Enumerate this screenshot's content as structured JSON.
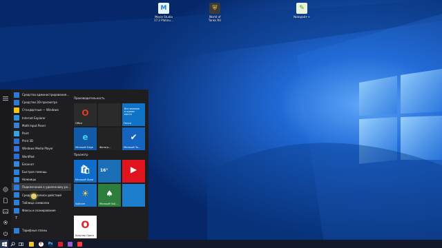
{
  "desktop": {
    "icons": [
      {
        "label": "Movie Studio\n17.2 Platinu…",
        "glyph": "M",
        "color": "#e9f3fb",
        "fg": "#1b7fd6"
      },
      {
        "label": "World of\nTanks RU",
        "glyph": "⛨",
        "color": "#3a3a36",
        "fg": "#c9a24a"
      },
      {
        "label": "Notepad++",
        "glyph": "✎",
        "color": "#e8f4da",
        "fg": "#4c9b2e"
      }
    ]
  },
  "start_menu": {
    "apps": [
      {
        "label": "Средства администрирования…",
        "color": "#2d7bd4"
      },
      {
        "label": "Средство 3D-просмотра",
        "color": "#2d7bd4"
      },
      {
        "label": "Стандартные — Windows",
        "color": "#f0c419"
      },
      {
        "label": "Internet Explorer",
        "color": "#2f8fe0"
      },
      {
        "label": "Math Input Panel",
        "color": "#3b7fd1"
      },
      {
        "label": "Paint",
        "color": "#3aa0e0"
      },
      {
        "label": "Print 3D",
        "color": "#2e6fd0"
      },
      {
        "label": "Windows Media Player",
        "color": "#2f74d6"
      },
      {
        "label": "WordPad",
        "color": "#2b6ed3"
      },
      {
        "label": "Блокнот",
        "color": "#3a86d8"
      },
      {
        "label": "Быстрая помощь",
        "color": "#2f80d9"
      },
      {
        "label": "Ножницы",
        "color": "#3187dd"
      },
      {
        "label": "Подключение к удаленному раб…",
        "color": "#2e7bd5"
      },
      {
        "label": "Средство записи действий",
        "color": "#2f7fd7"
      },
      {
        "label": "Таблица символов",
        "color": "#2f7fd7"
      },
      {
        "label": "Факсы и сканирование",
        "color": "#2f7fd7"
      }
    ],
    "letter": "Т",
    "last_app": {
      "label": "Тарифные планы",
      "color": "#2f7fd7"
    },
    "groups": [
      {
        "title": "Производительность"
      },
      {
        "title": "Просмотр"
      }
    ],
    "tiles": [
      {
        "label": "Office",
        "glyph": "O",
        "bg": "#2b2b2b",
        "fg": "#e23b1f"
      },
      {
        "label": "",
        "glyph": "",
        "bg": "#2b2b2b",
        "fg": "#fff"
      },
      {
        "label": "Почта",
        "glyph": "Все важные\nв одном\nместе",
        "bg": "#0f73c8",
        "fg": "#fff"
      },
      {
        "label": "Microsoft Edge",
        "glyph": "e",
        "bg": "#105aa8",
        "fg": "#3ad0f0"
      },
      {
        "label": "Фотогр…",
        "glyph": "",
        "bg": "#232323",
        "fg": "#fff"
      },
      {
        "label": "Microsoft To…",
        "glyph": "✔",
        "bg": "#1565c0",
        "fg": "#fff"
      },
      {
        "label": "Microsoft Store",
        "glyph": "🛍",
        "bg": "#0f6cc9",
        "fg": "#fff"
      },
      {
        "label": "",
        "glyph": "16°",
        "bg": "#1b6fb6",
        "fg": "#fff"
      },
      {
        "label": "",
        "glyph": "▶",
        "bg": "#e0141f",
        "fg": "#fff"
      },
      {
        "label": "Solitaire",
        "glyph": "☀",
        "bg": "#1972c3",
        "fg": "#ffd44a"
      },
      {
        "label": "Microsoft Soli…",
        "glyph": "♠",
        "bg": "#2d7d3c",
        "fg": "#fff"
      },
      {
        "label": "",
        "glyph": "",
        "bg": "#1c7ecd",
        "fg": "#fff"
      },
      {
        "label": "Браузер Opera",
        "glyph": "O",
        "bg": "#ffffff",
        "fg": "#e0202b"
      }
    ],
    "weather": {
      "temp": "16°",
      "hi": "16°"
    }
  },
  "taskbar": {
    "apps": [
      {
        "name": "file-explorer",
        "glyph": "",
        "color": "#f3c231"
      },
      {
        "name": "yandex-browser",
        "glyph": "Y",
        "color": "#ffffff"
      },
      {
        "name": "adobe-app",
        "glyph": "Ps",
        "color": "#0f2b4f"
      },
      {
        "name": "pdf-reader",
        "glyph": "",
        "color": "#d8222b"
      },
      {
        "name": "archive-app",
        "glyph": "",
        "color": "#9a5cd6"
      },
      {
        "name": "media-app",
        "glyph": "",
        "color": "#ff3b3b"
      }
    ]
  },
  "colors": {
    "accent": "#0f73c8",
    "taskbar": "#121a29",
    "start_bg": "#1e1e20"
  }
}
